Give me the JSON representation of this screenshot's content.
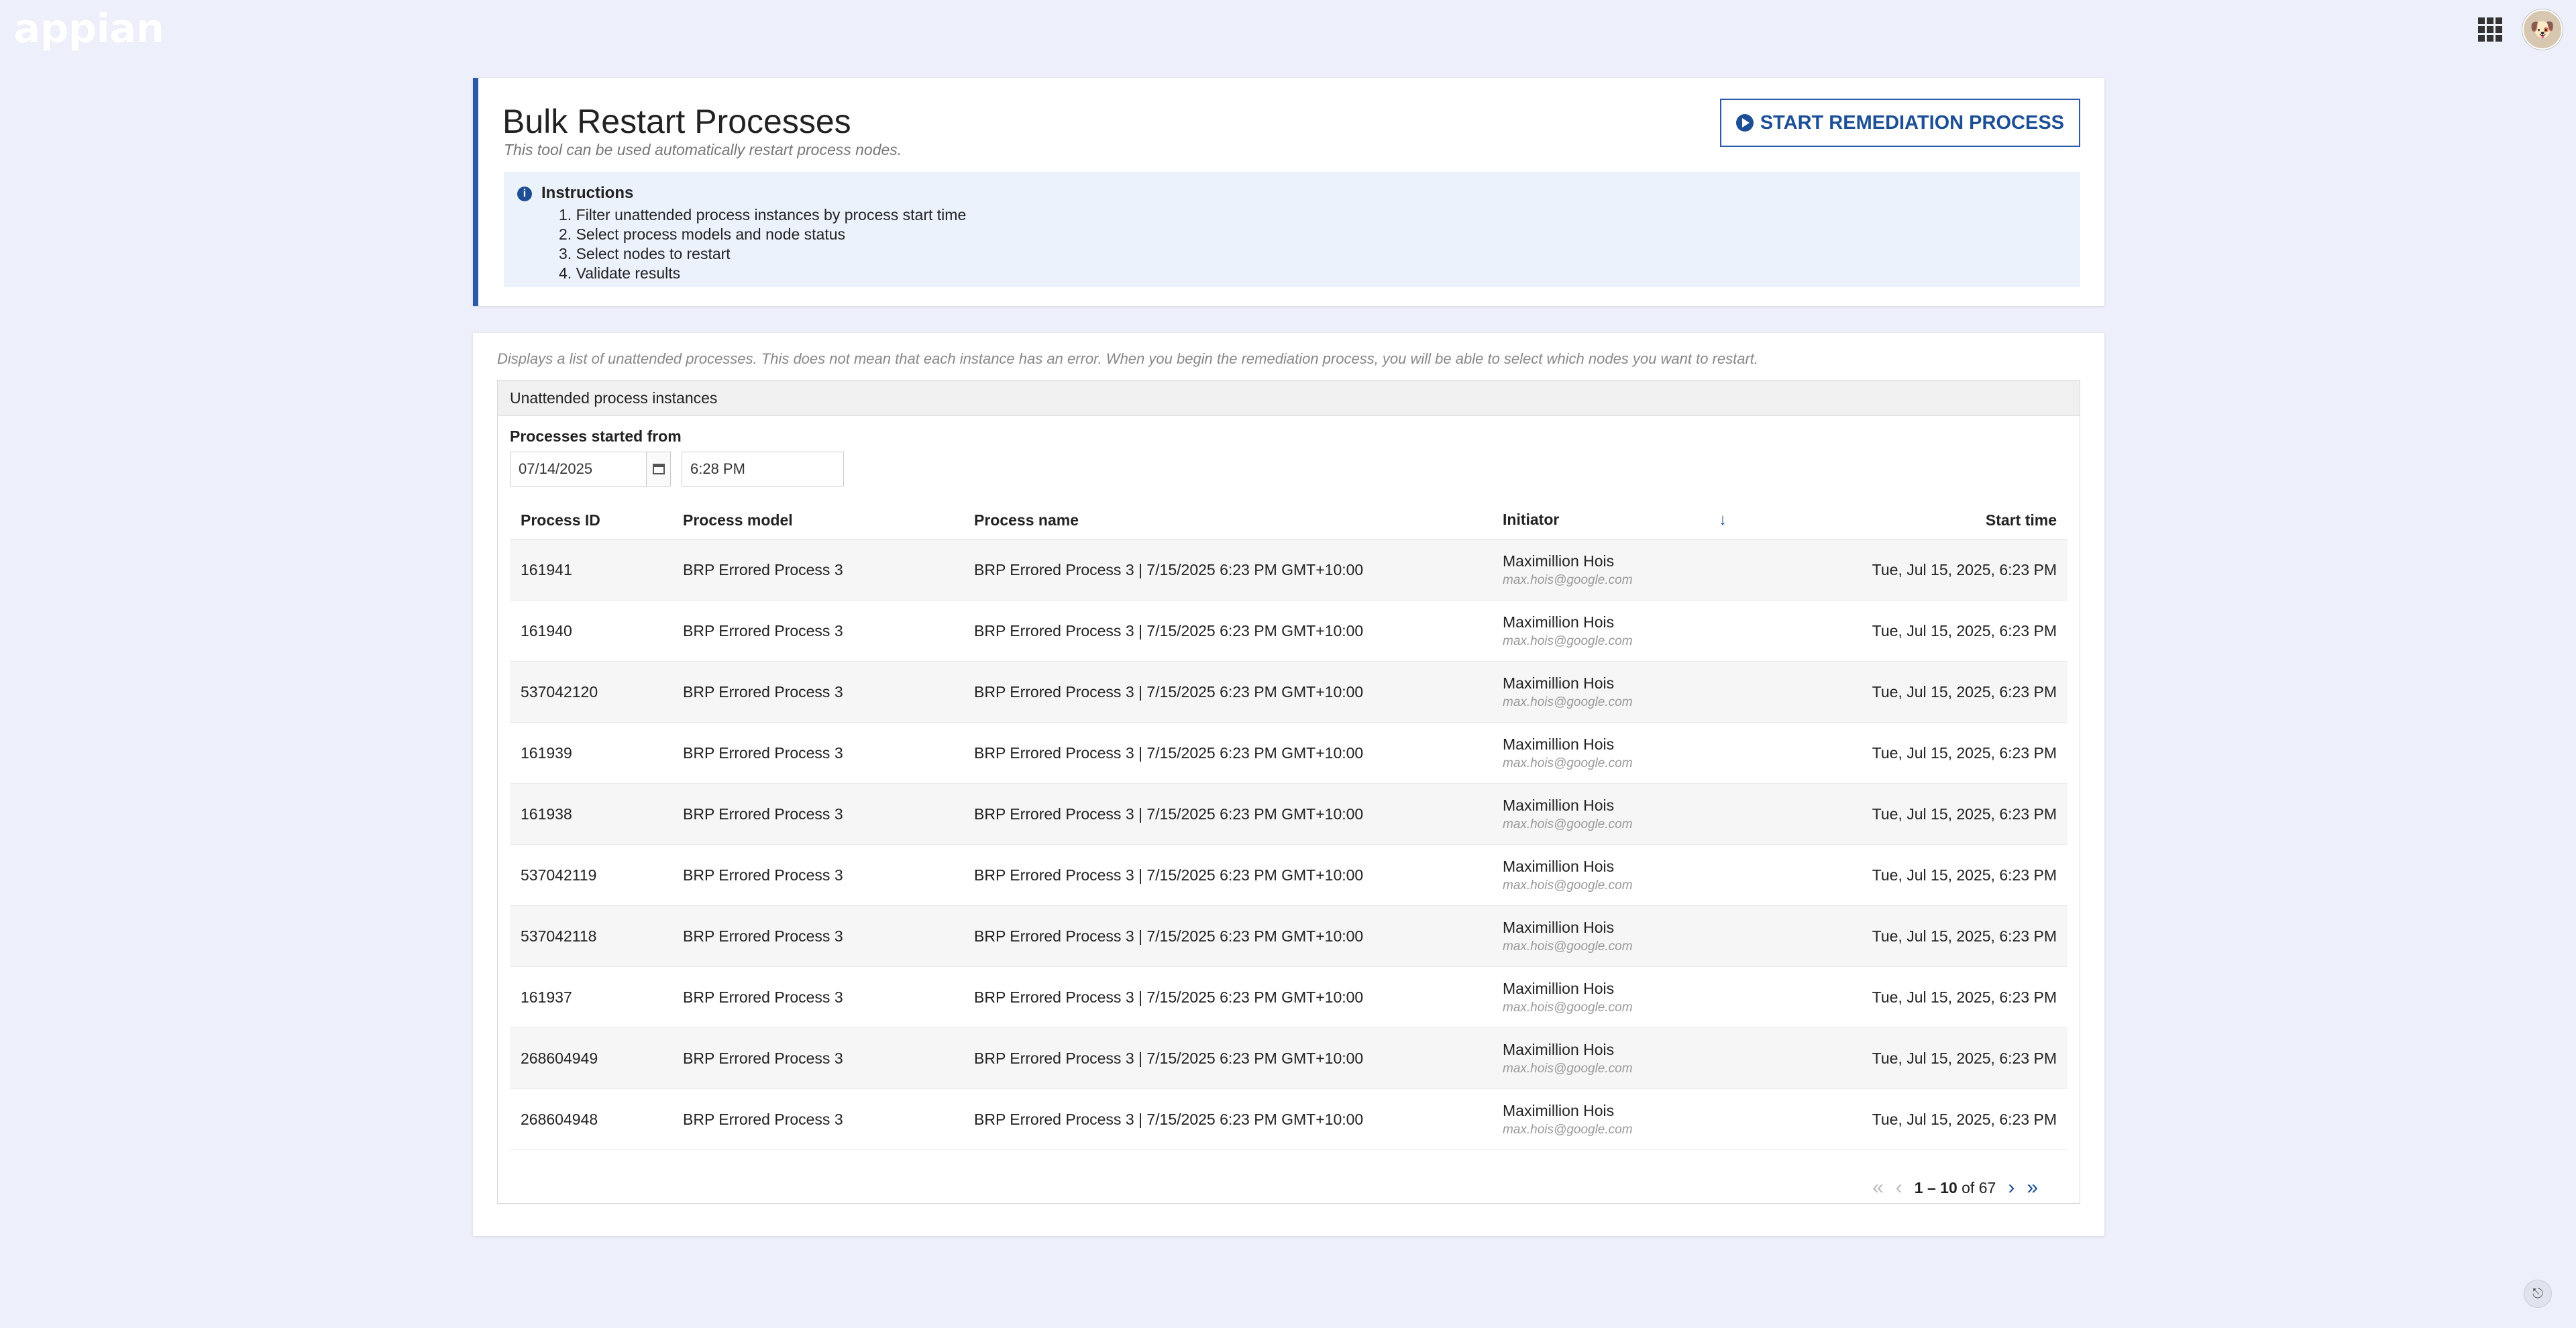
{
  "brand": {
    "logo": "appian"
  },
  "header": {
    "apps_icon": "grid-icon",
    "avatar_icon": "user-avatar"
  },
  "intro": {
    "title": "Bulk Restart Processes",
    "subtitle": "This tool can be used automatically restart process nodes.",
    "start_button": "START REMEDIATION PROCESS",
    "instructions_title": "Instructions",
    "instructions": [
      "1. Filter unattended process instances by process start time",
      "2. Select process models and node status",
      "3. Select nodes to restart",
      "4. Validate results"
    ]
  },
  "main": {
    "description": "Displays a list of unattended processes. This does not mean that each instance has an error. When you begin the remediation process, you will be able to select which nodes you want to restart.",
    "panel_title": "Unattended process instances",
    "filter_label": "Processes started from",
    "date_value": "07/14/2025",
    "time_value": "6:28 PM",
    "columns": [
      "Process ID",
      "Process model",
      "Process name",
      "Initiator",
      "Start time"
    ],
    "rows": [
      {
        "id": "161941",
        "model": "BRP Errored Process 3",
        "name": "BRP Errored Process 3 | 7/15/2025 6:23 PM GMT+10:00",
        "initiator": "Maximillion Hois",
        "email": "max.hois@google.com",
        "start": "Tue, Jul 15, 2025, 6:23 PM"
      },
      {
        "id": "161940",
        "model": "BRP Errored Process 3",
        "name": "BRP Errored Process 3 | 7/15/2025 6:23 PM GMT+10:00",
        "initiator": "Maximillion Hois",
        "email": "max.hois@google.com",
        "start": "Tue, Jul 15, 2025, 6:23 PM"
      },
      {
        "id": "537042120",
        "model": "BRP Errored Process 3",
        "name": "BRP Errored Process 3 | 7/15/2025 6:23 PM GMT+10:00",
        "initiator": "Maximillion Hois",
        "email": "max.hois@google.com",
        "start": "Tue, Jul 15, 2025, 6:23 PM"
      },
      {
        "id": "161939",
        "model": "BRP Errored Process 3",
        "name": "BRP Errored Process 3 | 7/15/2025 6:23 PM GMT+10:00",
        "initiator": "Maximillion Hois",
        "email": "max.hois@google.com",
        "start": "Tue, Jul 15, 2025, 6:23 PM"
      },
      {
        "id": "161938",
        "model": "BRP Errored Process 3",
        "name": "BRP Errored Process 3 | 7/15/2025 6:23 PM GMT+10:00",
        "initiator": "Maximillion Hois",
        "email": "max.hois@google.com",
        "start": "Tue, Jul 15, 2025, 6:23 PM"
      },
      {
        "id": "537042119",
        "model": "BRP Errored Process 3",
        "name": "BRP Errored Process 3 | 7/15/2025 6:23 PM GMT+10:00",
        "initiator": "Maximillion Hois",
        "email": "max.hois@google.com",
        "start": "Tue, Jul 15, 2025, 6:23 PM"
      },
      {
        "id": "537042118",
        "model": "BRP Errored Process 3",
        "name": "BRP Errored Process 3 | 7/15/2025 6:23 PM GMT+10:00",
        "initiator": "Maximillion Hois",
        "email": "max.hois@google.com",
        "start": "Tue, Jul 15, 2025, 6:23 PM"
      },
      {
        "id": "161937",
        "model": "BRP Errored Process 3",
        "name": "BRP Errored Process 3 | 7/15/2025 6:23 PM GMT+10:00",
        "initiator": "Maximillion Hois",
        "email": "max.hois@google.com",
        "start": "Tue, Jul 15, 2025, 6:23 PM"
      },
      {
        "id": "268604949",
        "model": "BRP Errored Process 3",
        "name": "BRP Errored Process 3 | 7/15/2025 6:23 PM GMT+10:00",
        "initiator": "Maximillion Hois",
        "email": "max.hois@google.com",
        "start": "Tue, Jul 15, 2025, 6:23 PM"
      },
      {
        "id": "268604948",
        "model": "BRP Errored Process 3",
        "name": "BRP Errored Process 3 | 7/15/2025 6:23 PM GMT+10:00",
        "initiator": "Maximillion Hois",
        "email": "max.hois@google.com",
        "start": "Tue, Jul 15, 2025, 6:23 PM"
      }
    ],
    "pager": {
      "range": "1 – 10",
      "of": "of",
      "total": "67"
    }
  },
  "colors": {
    "accent": "#2a5aa8",
    "background": "#edf0fb",
    "info_bg": "#ecf2fc"
  }
}
